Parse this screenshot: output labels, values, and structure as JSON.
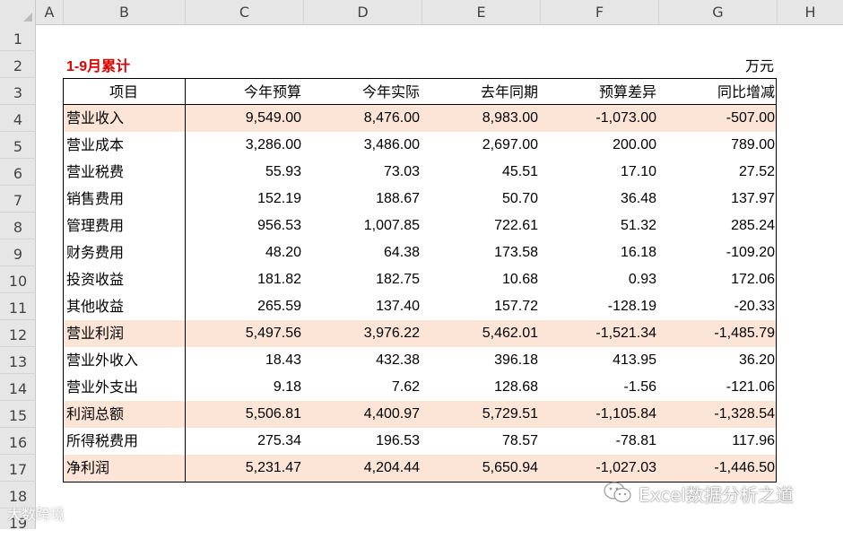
{
  "columns": [
    "A",
    "B",
    "C",
    "D",
    "E",
    "F",
    "G",
    "H"
  ],
  "rows": [
    "1",
    "2",
    "3",
    "4",
    "5",
    "6",
    "7",
    "8",
    "9",
    "10",
    "11",
    "12",
    "13",
    "14",
    "15",
    "16",
    "17",
    "18",
    "19"
  ],
  "title": "1-9月累计",
  "unit": "万元",
  "table": {
    "headers": [
      "项目",
      "今年预算",
      "今年实际",
      "去年同期",
      "预算差异",
      "同比增减"
    ],
    "rows": [
      {
        "item": "营业收入",
        "budget": "9,549.00",
        "actual": "8,476.00",
        "prior": "8,983.00",
        "bdiff": "-1,073.00",
        "yoy": "-507.00",
        "highlight": true
      },
      {
        "item": "营业成本",
        "budget": "3,286.00",
        "actual": "3,486.00",
        "prior": "2,697.00",
        "bdiff": "200.00",
        "yoy": "789.00",
        "highlight": false
      },
      {
        "item": "营业税费",
        "budget": "55.93",
        "actual": "73.03",
        "prior": "45.51",
        "bdiff": "17.10",
        "yoy": "27.52",
        "highlight": false
      },
      {
        "item": "销售费用",
        "budget": "152.19",
        "actual": "188.67",
        "prior": "50.70",
        "bdiff": "36.48",
        "yoy": "137.97",
        "highlight": false
      },
      {
        "item": "管理费用",
        "budget": "956.53",
        "actual": "1,007.85",
        "prior": "722.61",
        "bdiff": "51.32",
        "yoy": "285.24",
        "highlight": false
      },
      {
        "item": "财务费用",
        "budget": "48.20",
        "actual": "64.38",
        "prior": "173.58",
        "bdiff": "16.18",
        "yoy": "-109.20",
        "highlight": false
      },
      {
        "item": "投资收益",
        "budget": "181.82",
        "actual": "182.75",
        "prior": "10.68",
        "bdiff": "0.93",
        "yoy": "172.06",
        "highlight": false
      },
      {
        "item": "其他收益",
        "budget": "265.59",
        "actual": "137.40",
        "prior": "157.72",
        "bdiff": "-128.19",
        "yoy": "-20.33",
        "highlight": false
      },
      {
        "item": "营业利润",
        "budget": "5,497.56",
        "actual": "3,976.22",
        "prior": "5,462.01",
        "bdiff": "-1,521.34",
        "yoy": "-1,485.79",
        "highlight": true
      },
      {
        "item": "营业外收入",
        "budget": "18.43",
        "actual": "432.38",
        "prior": "396.18",
        "bdiff": "413.95",
        "yoy": "36.20",
        "highlight": false
      },
      {
        "item": "营业外支出",
        "budget": "9.18",
        "actual": "7.62",
        "prior": "128.68",
        "bdiff": "-1.56",
        "yoy": "-121.06",
        "highlight": false
      },
      {
        "item": "利润总额",
        "budget": "5,506.81",
        "actual": "4,400.97",
        "prior": "5,729.51",
        "bdiff": "-1,105.84",
        "yoy": "-1,328.54",
        "highlight": true
      },
      {
        "item": "所得税费用",
        "budget": "275.34",
        "actual": "196.53",
        "prior": "78.57",
        "bdiff": "-78.81",
        "yoy": "117.96",
        "highlight": false
      },
      {
        "item": "净利润",
        "budget": "5,231.47",
        "actual": "4,204.44",
        "prior": "5,650.94",
        "bdiff": "-1,027.03",
        "yoy": "-1,446.50",
        "highlight": true
      }
    ]
  },
  "watermark_right": "Excel数据分析之道",
  "watermark_left": "大数跨境",
  "colors": {
    "highlight": "#fce4d6",
    "title": "#e00000",
    "header_bg": "#e6e6e6"
  }
}
